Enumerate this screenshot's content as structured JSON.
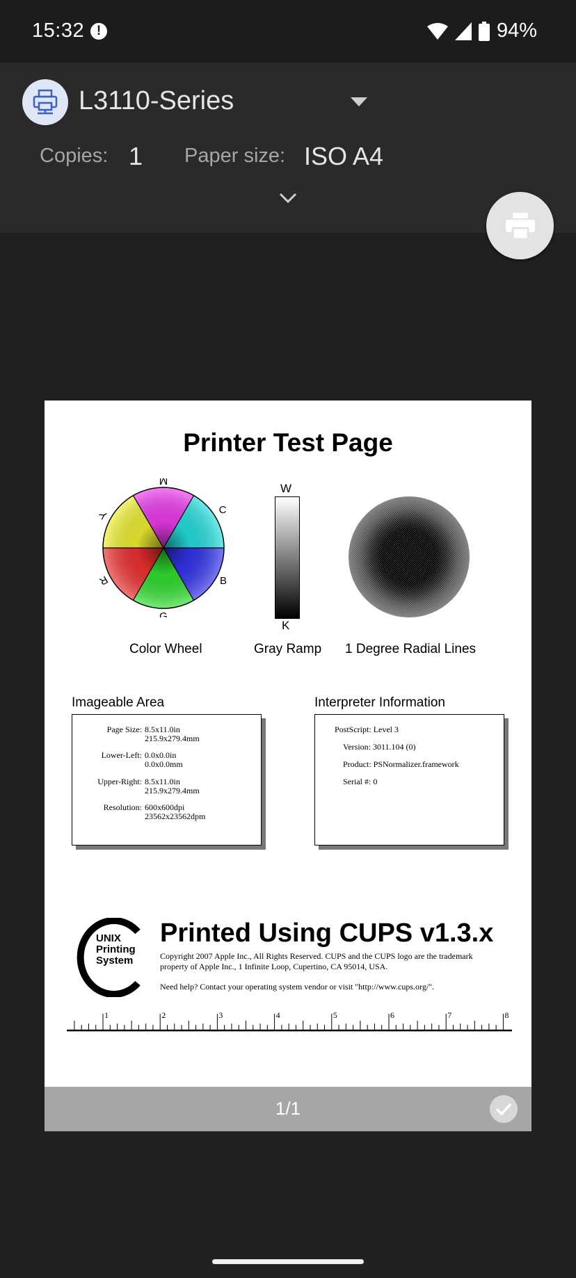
{
  "status_bar": {
    "time": "15:32",
    "alert_icon": "alert-circle-icon",
    "battery_percent": "94%",
    "icons": [
      "wifi-icon",
      "cellular-signal-icon",
      "battery-icon"
    ]
  },
  "printer": {
    "name": "L3110-Series",
    "icon": "network-printer-icon"
  },
  "settings": {
    "copies_label": "Copies:",
    "copies_value": "1",
    "paper_size_label": "Paper size:",
    "paper_size_value": "ISO A4"
  },
  "preview": {
    "title": "Printer Test Page",
    "color_wheel": {
      "caption": "Color Wheel",
      "labels": [
        "M",
        "C",
        "B",
        "G",
        "R",
        "Y"
      ]
    },
    "gray_ramp": {
      "caption": "Gray Ramp",
      "top_label": "W",
      "bottom_label": "K"
    },
    "radial": {
      "caption": "1 Degree Radial Lines"
    },
    "imageable_area": {
      "title": "Imageable Area",
      "rows": [
        {
          "key": "Page Size:",
          "v1": "8.5x11.0in",
          "v2": "215.9x279.4mm"
        },
        {
          "key": "Lower-Left:",
          "v1": "0.0x0.0in",
          "v2": "0.0x0.0mm"
        },
        {
          "key": "Upper-Right:",
          "v1": "8.5x11.0in",
          "v2": "215.9x279.4mm"
        },
        {
          "key": "Resolution:",
          "v1": "600x600dpi",
          "v2": "23562x23562dpm"
        }
      ]
    },
    "interpreter": {
      "title": "Interpreter Information",
      "rows": [
        {
          "key": "PostScript:",
          "value": "Level 3"
        },
        {
          "key": "Version:",
          "value": "3011.104 (0)"
        },
        {
          "key": "Product:",
          "value": "PSNormalizer.framework"
        },
        {
          "key": "Serial #:",
          "value": "0"
        }
      ]
    },
    "cups": {
      "logo_text_1": "UNIX",
      "logo_text_2": "Printing",
      "logo_text_3": "System",
      "title": "Printed Using CUPS v1.3.x",
      "copyright_1": "Copyright 2007 Apple Inc., All Rights Reserved. CUPS and the CUPS logo are the trademark",
      "copyright_2": "property of Apple Inc., 1 Infinite Loop, Cupertino, CA 95014, USA.",
      "help": "Need help? Contact your operating system vendor or visit \"http://www.cups.org/\"."
    },
    "ruler_labels": [
      "1",
      "2",
      "3",
      "4",
      "5",
      "6",
      "7",
      "8"
    ],
    "page_indicator": "1/1"
  }
}
